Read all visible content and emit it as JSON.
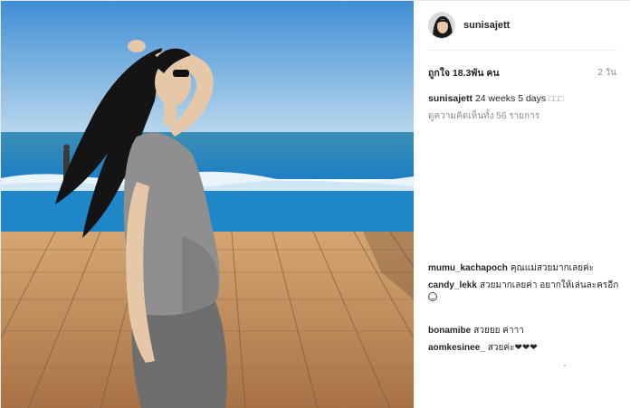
{
  "post": {
    "username": "sunisajett",
    "likes": "ถูกใจ 18.3พัน คน",
    "time_ago": "2 วัน",
    "caption": {
      "username": "sunisajett",
      "text": "24 weeks 5 days",
      "emoji": "□□□"
    },
    "view_all_comments": "ดูความคิดเห็นทั้ง 56 รายการ"
  },
  "comments": [
    {
      "username": "mumu_kachapoch",
      "text": "คุณแม่สวยมากเลยค่ะ"
    },
    {
      "username": "candy_lekk",
      "text": "สวยมากเลยค่า อยากให้เล่นละครอีก"
    },
    {
      "username": "bonamibe",
      "text": "สวยยย ค่าาา"
    },
    {
      "username": "aomkesinee_",
      "text": "สวยค่ะ❤❤❤"
    }
  ],
  "colors": {
    "sky_top": "#3e8fd6",
    "sky_bottom": "#b7d7ee",
    "sea": "#1f86c7",
    "deck": "#b9875a",
    "shirt": "#8c8c8c",
    "skirt": "#6e6e6e",
    "hair": "#141414"
  },
  "icons": {
    "avatar": "profile-photo",
    "photo": "post-photo"
  }
}
